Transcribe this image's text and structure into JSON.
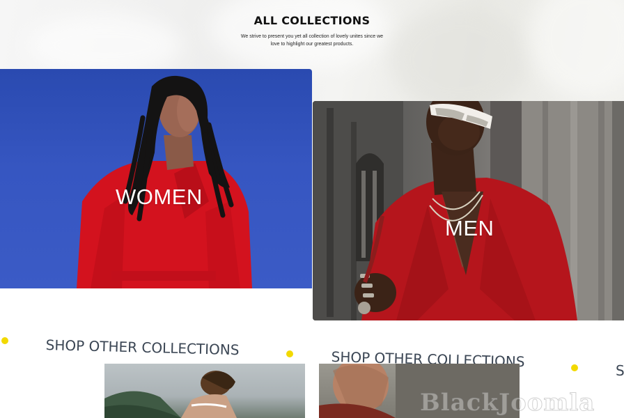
{
  "header": {
    "title": "ALL COLLECTIONS",
    "subtitle": "We strive to present you yet all collection of lovely unites since we love to highlight our greatest products."
  },
  "collections": [
    {
      "label": "WOMEN",
      "image": "woman-in-red-jacket-photo"
    },
    {
      "label": "MEN",
      "image": "man-in-red-blazer-photo"
    }
  ],
  "marquee": {
    "items": [
      "SHOP OTHER COLLECTIONS",
      "SHOP OTHER COLLECTIONS",
      "S"
    ],
    "dot_color": "#f2d900",
    "text_color": "#3b4654"
  },
  "watermark": "BlackJoomla",
  "colors": {
    "women_bg": "#3656c1",
    "men_jacket": "#b5151c",
    "women_jacket": "#d3121e"
  }
}
